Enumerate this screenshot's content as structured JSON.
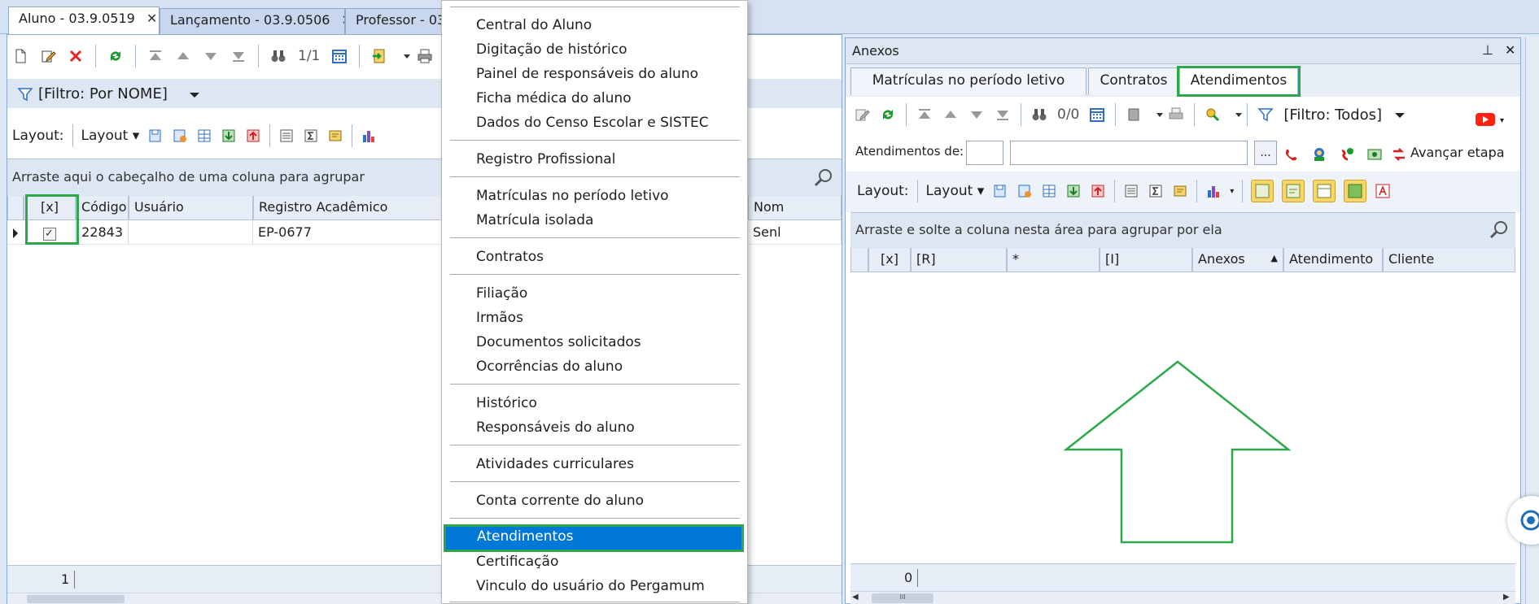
{
  "doc_tabs": [
    {
      "label": "Aluno - 03.9.0519",
      "close": "✕"
    },
    {
      "label": "Lançamento - 03.9.0506",
      "close": "✕"
    },
    {
      "label": "Professor - 03.",
      "close": ""
    }
  ],
  "left": {
    "pager": "1/1",
    "filter_label": "[Filtro: Por NOME]",
    "layout_label": "Layout:",
    "layout_dropdown": "Layout",
    "group_hint": "Arraste aqui o cabeçalho de uma coluna para agrupar",
    "columns": [
      "[x]",
      "Código",
      "Usuário",
      "Registro Acadêmico",
      "Nom"
    ],
    "row": {
      "checked": "✓",
      "codigo": "22843",
      "usuario": "",
      "registro": "EP-0677",
      "nome": "Senl"
    },
    "footer_count": "1"
  },
  "menu": {
    "groups": [
      [
        "Central do Aluno",
        "Digitação de histórico",
        "Painel de responsáveis do aluno",
        "Ficha médica do aluno",
        "Dados do Censo Escolar e SISTEC"
      ],
      [
        "Registro Profissional"
      ],
      [
        "Matrículas no período letivo",
        "Matrícula isolada"
      ],
      [
        "Contratos"
      ],
      [
        "Filiação",
        "Irmãos",
        "Documentos solicitados",
        "Ocorrências do aluno"
      ],
      [
        "Histórico",
        "Responsáveis do aluno"
      ],
      [
        "Atividades curriculares"
      ],
      [
        "Conta corrente do aluno"
      ],
      [
        "Atendimentos",
        "Certificação",
        "Vinculo do usuário do Pergamum"
      ]
    ],
    "selected": "Atendimentos"
  },
  "right": {
    "title": "Anexos",
    "pin": "⊥",
    "close": "✕",
    "tabs": [
      "Matrículas no período letivo",
      "Contratos",
      "Atendimentos"
    ],
    "active_tab": "Atendimentos",
    "pager": "0/0",
    "filter_label": "[Filtro: Todos]",
    "atend_label": "Atendimentos de:",
    "browse_btn": "...",
    "avancar_label": "Avançar etapa",
    "layout_label": "Layout:",
    "layout_dropdown": "Layout",
    "group_hint": "Arraste e solte a coluna nesta área para agrupar por ela",
    "columns": [
      "[x]",
      "[R]",
      "*",
      "[I]",
      "Anexos",
      "Atendimento",
      "Cliente"
    ],
    "sort_glyph": "▲",
    "footer_count": "0",
    "scroll_thumb": "III"
  },
  "colors": {
    "green": "#2ba84a",
    "selection": "#0078d7",
    "panel_border": "#8ea7cc"
  }
}
